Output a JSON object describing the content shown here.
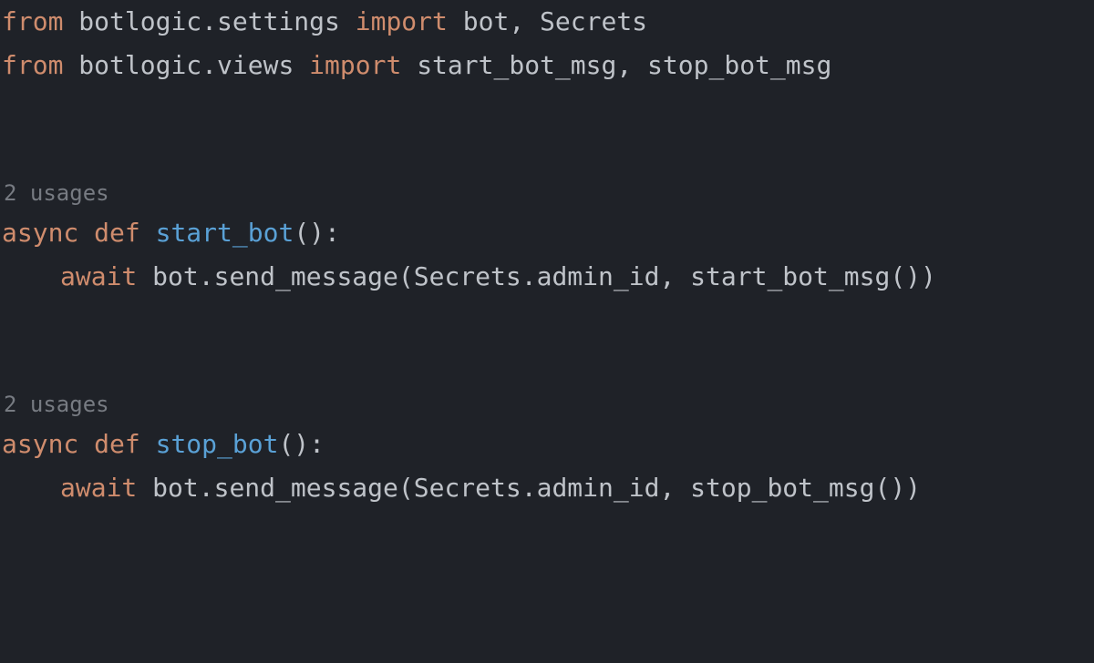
{
  "code": {
    "line1": {
      "from": "from",
      "mod": "botlogic.settings",
      "import": "import",
      "names": "bot, Secrets"
    },
    "line2": {
      "from": "from",
      "mod": "botlogic.views",
      "import": "import",
      "names": "start_bot_msg, stop_bot_msg"
    },
    "hint1": "2 usages",
    "func1": {
      "async": "async",
      "def": "def",
      "name": "start_bot",
      "sig": "():",
      "body_await": "await",
      "body_rest": "bot.send_message(Secrets.admin_id, start_bot_msg())"
    },
    "hint2": "2 usages",
    "func2": {
      "async": "async",
      "def": "def",
      "name": "stop_bot",
      "sig": "():",
      "body_await": "await",
      "body_rest": "bot.send_message(Secrets.admin_id, stop_bot_msg())"
    }
  }
}
